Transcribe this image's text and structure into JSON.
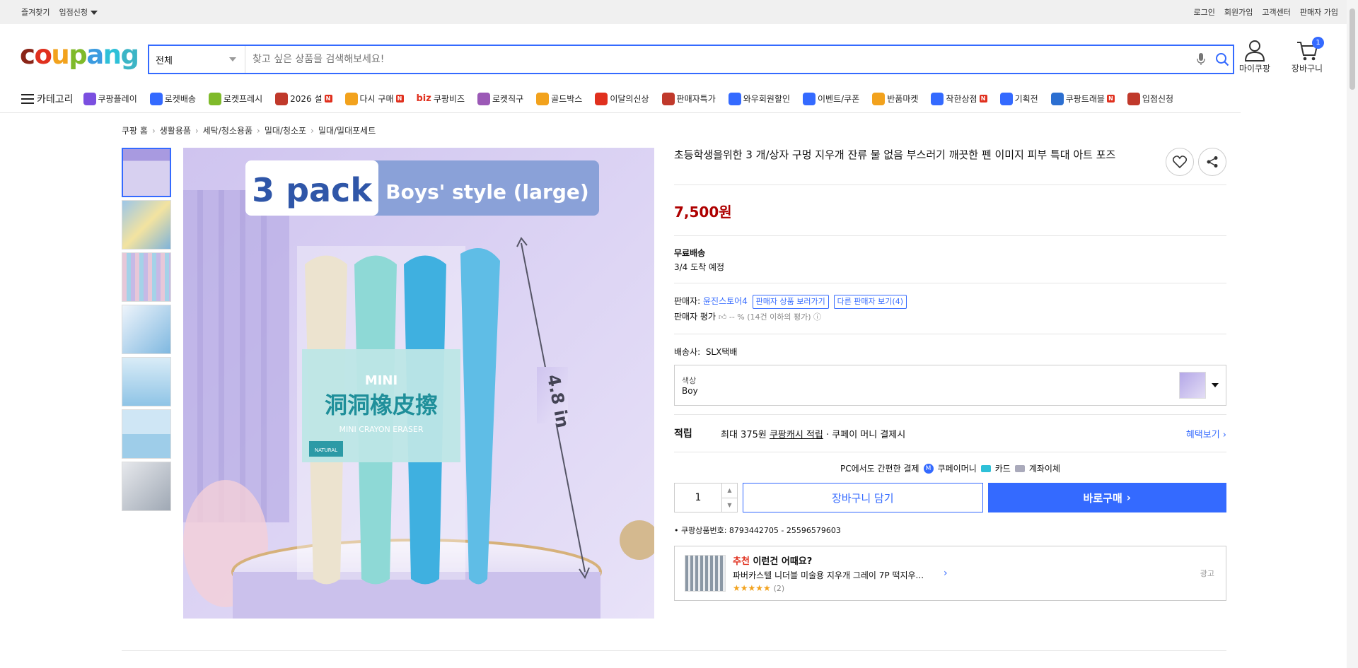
{
  "topbar": {
    "left": [
      "즐겨찾기",
      "입점신청"
    ],
    "right": [
      "로그인",
      "회원가입",
      "고객센터",
      "판매자 가입"
    ]
  },
  "header": {
    "logo": [
      "c",
      "o",
      "u",
      "p",
      "a",
      "n",
      "g"
    ],
    "search_category": "전체",
    "search_placeholder": "찾고 싶은 상품을 검색해보세요!",
    "my_label": "마이쿠팡",
    "cart_label": "장바구니",
    "cart_count": "1"
  },
  "nav": {
    "category_label": "카테고리",
    "items": [
      {
        "label": "쿠팡플레이",
        "color": "#7b4fe0",
        "badge": ""
      },
      {
        "label": "로켓배송",
        "color": "#346aff",
        "badge": ""
      },
      {
        "label": "로켓프레시",
        "color": "#7fba2a",
        "badge": ""
      },
      {
        "label": "2026 설",
        "color": "#c0392b",
        "badge": "N"
      },
      {
        "label": "다시 구매",
        "color": "#f2a21d",
        "badge": "N"
      },
      {
        "label": "쿠팡비즈",
        "color": "#e0301e",
        "badge": "",
        "prefix": "biz"
      },
      {
        "label": "로켓직구",
        "color": "#9b59b6",
        "badge": ""
      },
      {
        "label": "골드박스",
        "color": "#f2a21d",
        "badge": ""
      },
      {
        "label": "이달의신상",
        "color": "#e0301e",
        "badge": ""
      },
      {
        "label": "판매자특가",
        "color": "#c0392b",
        "badge": ""
      },
      {
        "label": "와우회원할인",
        "color": "#346aff",
        "badge": ""
      },
      {
        "label": "이벤트/쿠폰",
        "color": "#346aff",
        "badge": ""
      },
      {
        "label": "반품마켓",
        "color": "#f2a21d",
        "badge": ""
      },
      {
        "label": "착한상점",
        "color": "#346aff",
        "badge": "N"
      },
      {
        "label": "기획전",
        "color": "#346aff",
        "badge": ""
      },
      {
        "label": "쿠팡트래블",
        "color": "#2c6fd1",
        "badge": "N"
      },
      {
        "label": "입점신청",
        "color": "#c0392b",
        "badge": ""
      }
    ]
  },
  "breadcrumb": [
    "쿠팡 홈",
    "생활용품",
    "세탁/청소용품",
    "밀대/청소포",
    "밀대/밀대포세트"
  ],
  "image": {
    "pack": "3 pack",
    "style": "Boys' style (large)",
    "mini": "MINI",
    "cn": "洞洞橡皮擦",
    "sub": "MINI CRAYON ERASER",
    "natural": "NATURAL",
    "size": "4.8 in"
  },
  "product": {
    "title": "초등학생을위한 3 개/상자 구멍 지우개 잔류 물 없음 부스러기 깨끗한 펜 이미지 피부 특대 아트 포즈",
    "price": "7,500원",
    "shipping_title": "무료배송",
    "shipping_eta": "3/4 도착 예정",
    "seller_label": "판매자:",
    "seller_name": "윤진스토어4",
    "seller_products_btn": "판매자 상품 보러가기",
    "other_sellers_btn": "다른 판매자 보기(4)",
    "rating_label": "판매자 평가",
    "rating_value": "-- % (14건 이하의 평가)",
    "courier_label": "배송사:",
    "courier": "SLX택배",
    "option_label": "색상",
    "option_value": "Boy",
    "reward_heading": "적립",
    "reward_prefix": "최대 375원",
    "reward_link": "쿠팡캐시 적립",
    "reward_suffix": "· 쿠페이 머니 결제시",
    "reward_benefit": "혜택보기 ›",
    "pay_title": "PC에서도 간편한 결제",
    "pay_money": "쿠페이머니",
    "pay_card": "카드",
    "pay_bank": "계좌이체",
    "qty": "1",
    "cart_btn": "장바구니 담기",
    "buy_btn": "바로구매",
    "product_id": "• 쿠팡상품번호: 8793442705 - 25596579603"
  },
  "recommend": {
    "title_red": "추천",
    "title": "이런건 어때요?",
    "name": "파버카스텔 니더블 미술용 지우개 그레이 7P 떡지우...",
    "stars": "★★★★★",
    "count": "(2)",
    "ad": "광고"
  }
}
